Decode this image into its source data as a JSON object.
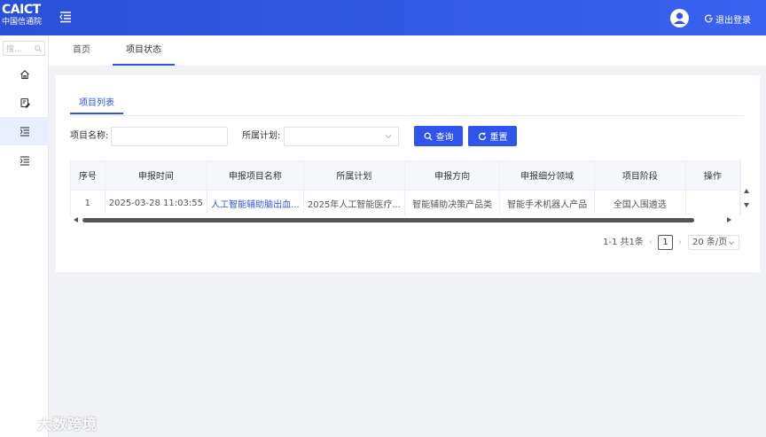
{
  "header": {
    "logo_main": "CAICT",
    "logo_sub": "中国信通院",
    "logout_label": "退出登录"
  },
  "sidebar": {
    "search_placeholder": "搜..."
  },
  "tabs": [
    {
      "label": "首页"
    },
    {
      "label": "项目状态"
    }
  ],
  "main": {
    "inner_tab": "项目列表",
    "form": {
      "name_label": "项目名称:",
      "name_value": "",
      "plan_label": "所属计划:",
      "plan_value": "",
      "query_label": "查询",
      "reset_label": "重置"
    },
    "table": {
      "columns": [
        "序号",
        "申报时间",
        "申报项目名称",
        "所属计划",
        "申报方向",
        "申报细分领域",
        "项目阶段",
        "操作"
      ],
      "rows": [
        [
          "1",
          "2025-03-28 11:03:55",
          "人工智能辅助脑出血...",
          "2025年人工智能医疗...",
          "智能辅助决策产品类",
          "智能手术机器人产品",
          "全国入围遴选",
          ""
        ]
      ]
    },
    "pagination": {
      "total_text": "1-1 共1条",
      "current_page": "1",
      "page_size": "20 条/页"
    }
  },
  "watermark": {
    "text": "大数跨境"
  },
  "colors": {
    "primary": "#2f54eb",
    "header_bg": "#2f54eb",
    "link": "#2f54eb"
  }
}
